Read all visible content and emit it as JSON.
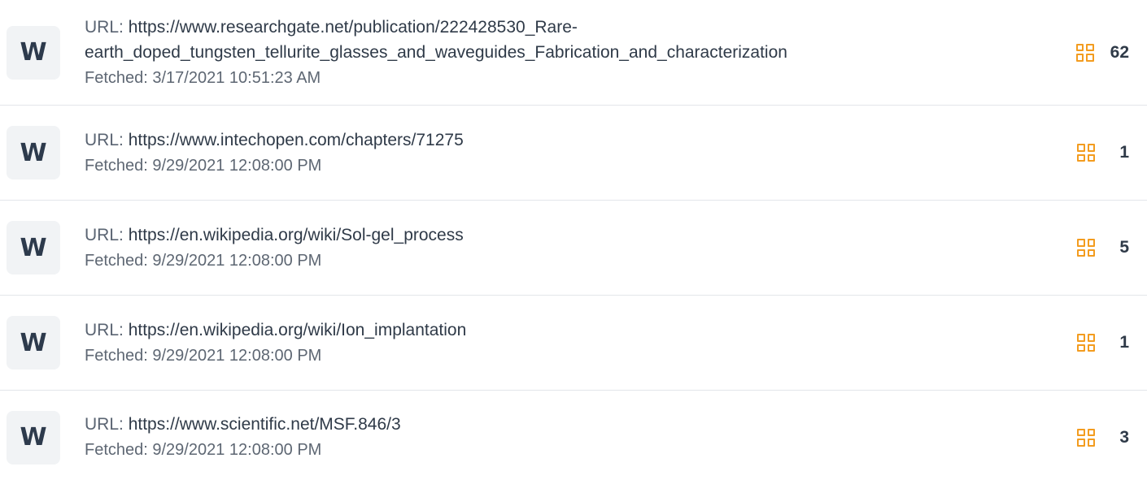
{
  "source_list": {
    "items": [
      {
        "badge": "W",
        "url_label": "URL:",
        "url_line1": "https://www.researchgate.net/publication/222428530_Rare-",
        "url_line2": "earth_doped_tungsten_tellurite_glasses_and_waveguides_Fabrication_and_characterization",
        "fetched": "Fetched: 3/17/2021 10:51:23 AM",
        "match_icon": "grid-icon",
        "count": "62"
      },
      {
        "badge": "W",
        "url_label": "URL:",
        "url": "https://www.intechopen.com/chapters/71275",
        "fetched": "Fetched: 9/29/2021 12:08:00 PM",
        "match_icon": "grid-icon",
        "count": "1"
      },
      {
        "badge": "W",
        "url_label": "URL:",
        "url": "https://en.wikipedia.org/wiki/Sol-gel_process",
        "fetched": "Fetched: 9/29/2021 12:08:00 PM",
        "match_icon": "grid-icon",
        "count": "5"
      },
      {
        "badge": "W",
        "url_label": "URL:",
        "url": "https://en.wikipedia.org/wiki/Ion_implantation",
        "fetched": "Fetched: 9/29/2021 12:08:00 PM",
        "match_icon": "grid-icon",
        "count": "1"
      },
      {
        "badge": "W",
        "url_label": "URL:",
        "url": "https://www.scientific.net/MSF.846/3",
        "fetched": "Fetched: 9/29/2021 12:08:00 PM",
        "match_icon": "grid-icon",
        "count": "3"
      }
    ]
  },
  "colors": {
    "accent_icon": "#f39c1f",
    "text": "#2f3a48",
    "badge_bg": "#f1f3f5",
    "divider": "#e3e6ea"
  }
}
